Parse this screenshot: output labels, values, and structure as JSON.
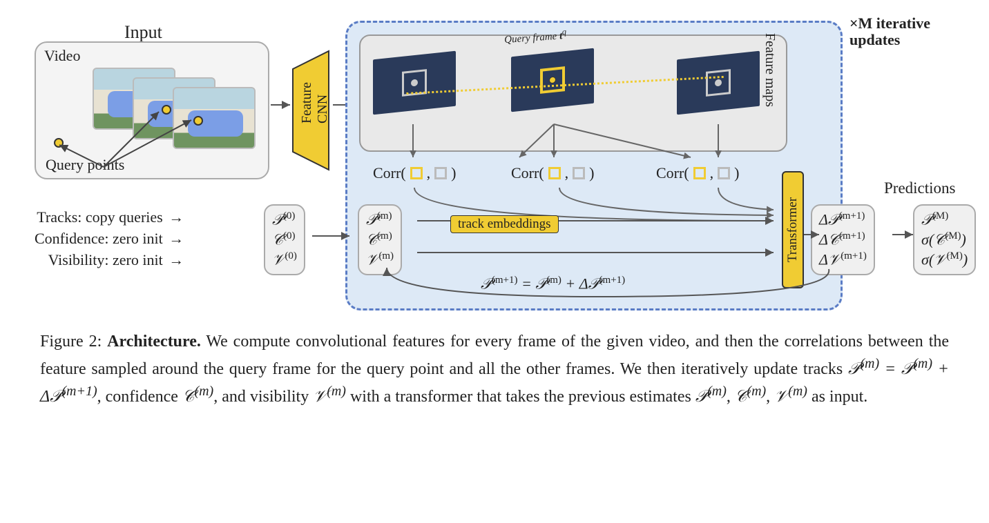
{
  "input": {
    "title": "Input",
    "video_label": "Video",
    "query_points_label": "Query points"
  },
  "cnn_label": "Feature\nCNN",
  "iterative": {
    "m_updates": "×M iterative\nupdates",
    "feature_maps_label": "Feature maps",
    "query_frame_label": "Query frame tq",
    "corr_label": "Corr",
    "track_embeddings": "track embeddings",
    "transformer": "Transformer",
    "update_eq": "𝒫(m+1) = 𝒫(m) + Δ𝒫(m+1)"
  },
  "init": {
    "tracks": "Tracks: copy queries",
    "conf": "Confidence: zero init",
    "vis": "Visibility: zero init"
  },
  "state0": {
    "P": "𝒫(0)",
    "C": "𝒞(0)",
    "V": "𝒱(0)"
  },
  "state_m": {
    "P": "𝒫(m)",
    "C": "𝒞(m)",
    "V": "𝒱(m)"
  },
  "delta": {
    "P": "Δ𝒫(m+1)",
    "C": "Δ𝒞(m+1)",
    "V": "Δ𝒱(m+1)"
  },
  "pred": {
    "label": "Predictions",
    "P": "𝒫(M)",
    "C": "σ(𝒞(M))",
    "V": "σ(𝒱(M))"
  },
  "caption": {
    "fig_num": "Figure 2:",
    "title": "Architecture.",
    "body": "We compute convolutional features for every frame of the given video, and then the correlations between the feature sampled around the query frame for the query point and all the other frames. We then iteratively update tracks 𝒫(m) = 𝒫(m) + Δ𝒫(m+1), confidence 𝒞(m), and visibility 𝒱(m) with a transformer that takes the previous estimates 𝒫(m), 𝒞(m), 𝒱(m) as input."
  }
}
